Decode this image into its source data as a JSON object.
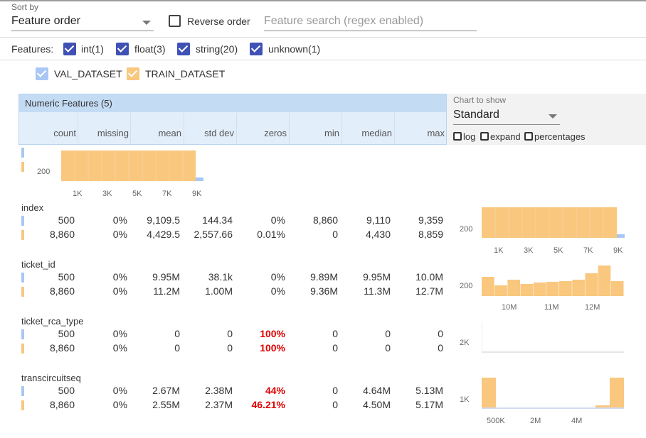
{
  "toolbar": {
    "sort_by_label": "Sort by",
    "sort_by_value": "Feature order",
    "reverse_label": "Reverse order",
    "reverse_checked": false,
    "search_placeholder": "Feature search (regex enabled)",
    "search_value": ""
  },
  "filters": {
    "label": "Features:",
    "items": [
      {
        "label": "int(1)",
        "checked": true
      },
      {
        "label": "float(3)",
        "checked": true
      },
      {
        "label": "string(20)",
        "checked": true
      },
      {
        "label": "unknown(1)",
        "checked": true
      }
    ]
  },
  "datasets": [
    {
      "label": "VAL_DATASET",
      "color": "#a8c7f5"
    },
    {
      "label": "TRAIN_DATASET",
      "color": "#f9c77e"
    }
  ],
  "table": {
    "title": "Numeric Features (5)",
    "columns": [
      "count",
      "missing",
      "mean",
      "std dev",
      "zeros",
      "min",
      "median",
      "max"
    ]
  },
  "chart_panel": {
    "label": "Chart to show",
    "value": "Standard",
    "options": [
      {
        "label": "log",
        "checked": false
      },
      {
        "label": "expand",
        "checked": false
      },
      {
        "label": "percentages",
        "checked": false
      }
    ]
  },
  "top_chart": {
    "y_label": "200",
    "x_ticks": [
      "1K",
      "3K",
      "5K",
      "7K",
      "9K"
    ]
  },
  "features": [
    {
      "name": "index",
      "rows": [
        [
          "500",
          "0%",
          "9,109.5",
          "144.34",
          "0%",
          "8,860",
          "9,110",
          "9,359"
        ],
        [
          "8,860",
          "0%",
          "4,429.5",
          "2,557.66",
          "0.01%",
          "0",
          "4,430",
          "8,859"
        ]
      ],
      "zeros_highlight": false,
      "chart": {
        "y_label": "200",
        "x_ticks": [
          "1K",
          "3K",
          "5K",
          "7K",
          "9K"
        ]
      }
    },
    {
      "name": "ticket_id",
      "rows": [
        [
          "500",
          "0%",
          "9.95M",
          "38.1k",
          "0%",
          "9.89M",
          "9.95M",
          "10.0M"
        ],
        [
          "8,860",
          "0%",
          "11.2M",
          "1.00M",
          "0%",
          "9.36M",
          "11.3M",
          "12.7M"
        ]
      ],
      "zeros_highlight": false,
      "chart": {
        "y_label": "200",
        "x_ticks": [
          "10M",
          "11M",
          "12M"
        ],
        "heights": [
          0.62,
          0.33,
          0.52,
          0.38,
          0.43,
          0.45,
          0.48,
          0.52,
          0.72,
          0.98,
          0.48
        ]
      }
    },
    {
      "name": "ticket_rca_type",
      "rows": [
        [
          "500",
          "0%",
          "0",
          "0",
          "100%",
          "0",
          "0",
          "0"
        ],
        [
          "8,860",
          "0%",
          "0",
          "0",
          "100%",
          "0",
          "0",
          "0"
        ]
      ],
      "zeros_highlight": true,
      "chart": {
        "y_label": "2K",
        "x_ticks": []
      }
    },
    {
      "name": "transcircuitseq",
      "rows": [
        [
          "500",
          "0%",
          "2.67M",
          "2.38M",
          "44%",
          "0",
          "4.64M",
          "5.13M"
        ],
        [
          "8,860",
          "0%",
          "2.55M",
          "2.37M",
          "46.21%",
          "0",
          "4.50M",
          "5.17M"
        ]
      ],
      "zeros_highlight": true,
      "chart": {
        "y_label": "1K",
        "x_ticks": [
          "500K",
          "2M",
          "4M"
        ]
      }
    }
  ]
}
